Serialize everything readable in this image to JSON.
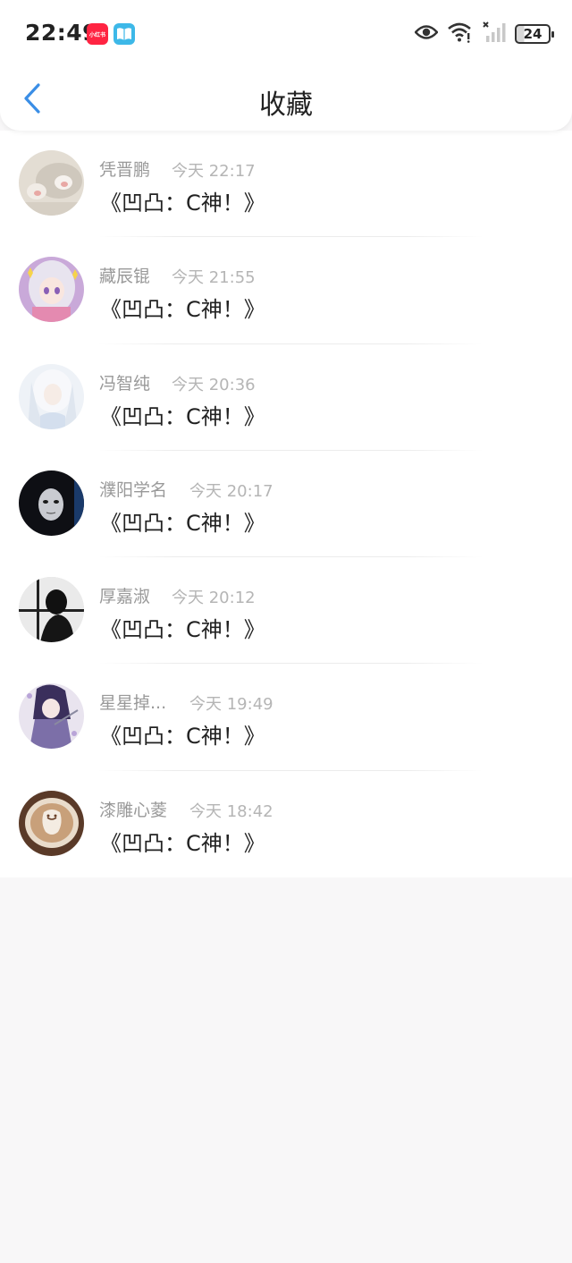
{
  "status_bar": {
    "time": "22:49",
    "app_icons": [
      "xiaohongshu-icon",
      "book-app-icon"
    ],
    "xiaohongshu_label": "小红书",
    "battery": "24"
  },
  "header": {
    "title": "收藏"
  },
  "colors": {
    "accent": "#3a8ee6",
    "name_text": "#999999",
    "time_text": "#b5b5b5"
  },
  "items": [
    {
      "name": "凭晋鹏",
      "time": "今天 22:17",
      "message": "《凹凸：C神！》"
    },
    {
      "name": "藏辰锟",
      "time": "今天 21:55",
      "message": "《凹凸：C神！》"
    },
    {
      "name": "冯智纯",
      "time": "今天 20:36",
      "message": "《凹凸：C神！》"
    },
    {
      "name": "濮阳学名",
      "time": "今天 20:17",
      "message": "《凹凸：C神！》"
    },
    {
      "name": "厚嘉淑",
      "time": "今天 20:12",
      "message": "《凹凸：C神！》"
    },
    {
      "name": "星星掉...",
      "time": "今天 19:49",
      "message": "《凹凸：C神！》"
    },
    {
      "name": "漆雕心菱",
      "time": "今天 18:42",
      "message": "《凹凸：C神！》"
    }
  ]
}
